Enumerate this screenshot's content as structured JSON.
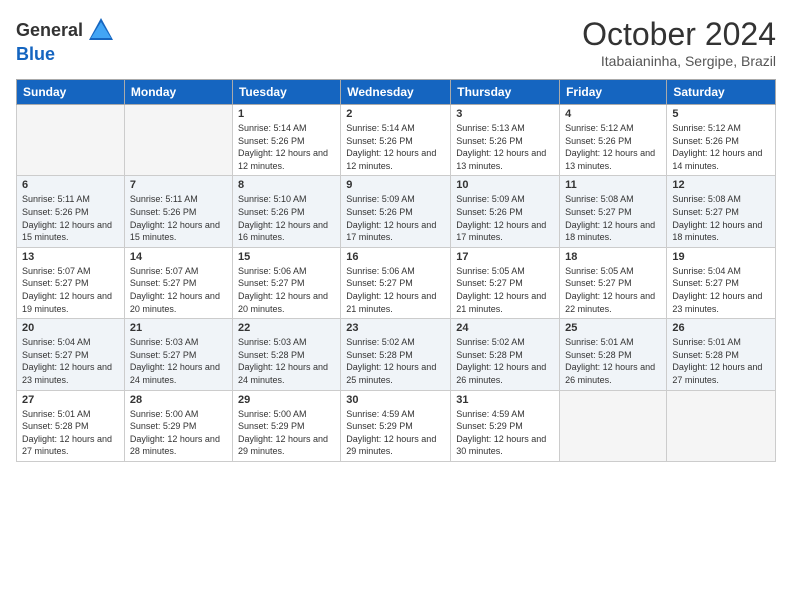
{
  "header": {
    "logo_general": "General",
    "logo_blue": "Blue",
    "month": "October 2024",
    "location": "Itabaianinha, Sergipe, Brazil"
  },
  "days_of_week": [
    "Sunday",
    "Monday",
    "Tuesday",
    "Wednesday",
    "Thursday",
    "Friday",
    "Saturday"
  ],
  "weeks": [
    [
      {
        "day": "",
        "info": ""
      },
      {
        "day": "",
        "info": ""
      },
      {
        "day": "1",
        "info": "Sunrise: 5:14 AM\nSunset: 5:26 PM\nDaylight: 12 hours and 12 minutes."
      },
      {
        "day": "2",
        "info": "Sunrise: 5:14 AM\nSunset: 5:26 PM\nDaylight: 12 hours and 12 minutes."
      },
      {
        "day": "3",
        "info": "Sunrise: 5:13 AM\nSunset: 5:26 PM\nDaylight: 12 hours and 13 minutes."
      },
      {
        "day": "4",
        "info": "Sunrise: 5:12 AM\nSunset: 5:26 PM\nDaylight: 12 hours and 13 minutes."
      },
      {
        "day": "5",
        "info": "Sunrise: 5:12 AM\nSunset: 5:26 PM\nDaylight: 12 hours and 14 minutes."
      }
    ],
    [
      {
        "day": "6",
        "info": "Sunrise: 5:11 AM\nSunset: 5:26 PM\nDaylight: 12 hours and 15 minutes."
      },
      {
        "day": "7",
        "info": "Sunrise: 5:11 AM\nSunset: 5:26 PM\nDaylight: 12 hours and 15 minutes."
      },
      {
        "day": "8",
        "info": "Sunrise: 5:10 AM\nSunset: 5:26 PM\nDaylight: 12 hours and 16 minutes."
      },
      {
        "day": "9",
        "info": "Sunrise: 5:09 AM\nSunset: 5:26 PM\nDaylight: 12 hours and 17 minutes."
      },
      {
        "day": "10",
        "info": "Sunrise: 5:09 AM\nSunset: 5:26 PM\nDaylight: 12 hours and 17 minutes."
      },
      {
        "day": "11",
        "info": "Sunrise: 5:08 AM\nSunset: 5:27 PM\nDaylight: 12 hours and 18 minutes."
      },
      {
        "day": "12",
        "info": "Sunrise: 5:08 AM\nSunset: 5:27 PM\nDaylight: 12 hours and 18 minutes."
      }
    ],
    [
      {
        "day": "13",
        "info": "Sunrise: 5:07 AM\nSunset: 5:27 PM\nDaylight: 12 hours and 19 minutes."
      },
      {
        "day": "14",
        "info": "Sunrise: 5:07 AM\nSunset: 5:27 PM\nDaylight: 12 hours and 20 minutes."
      },
      {
        "day": "15",
        "info": "Sunrise: 5:06 AM\nSunset: 5:27 PM\nDaylight: 12 hours and 20 minutes."
      },
      {
        "day": "16",
        "info": "Sunrise: 5:06 AM\nSunset: 5:27 PM\nDaylight: 12 hours and 21 minutes."
      },
      {
        "day": "17",
        "info": "Sunrise: 5:05 AM\nSunset: 5:27 PM\nDaylight: 12 hours and 21 minutes."
      },
      {
        "day": "18",
        "info": "Sunrise: 5:05 AM\nSunset: 5:27 PM\nDaylight: 12 hours and 22 minutes."
      },
      {
        "day": "19",
        "info": "Sunrise: 5:04 AM\nSunset: 5:27 PM\nDaylight: 12 hours and 23 minutes."
      }
    ],
    [
      {
        "day": "20",
        "info": "Sunrise: 5:04 AM\nSunset: 5:27 PM\nDaylight: 12 hours and 23 minutes."
      },
      {
        "day": "21",
        "info": "Sunrise: 5:03 AM\nSunset: 5:27 PM\nDaylight: 12 hours and 24 minutes."
      },
      {
        "day": "22",
        "info": "Sunrise: 5:03 AM\nSunset: 5:28 PM\nDaylight: 12 hours and 24 minutes."
      },
      {
        "day": "23",
        "info": "Sunrise: 5:02 AM\nSunset: 5:28 PM\nDaylight: 12 hours and 25 minutes."
      },
      {
        "day": "24",
        "info": "Sunrise: 5:02 AM\nSunset: 5:28 PM\nDaylight: 12 hours and 26 minutes."
      },
      {
        "day": "25",
        "info": "Sunrise: 5:01 AM\nSunset: 5:28 PM\nDaylight: 12 hours and 26 minutes."
      },
      {
        "day": "26",
        "info": "Sunrise: 5:01 AM\nSunset: 5:28 PM\nDaylight: 12 hours and 27 minutes."
      }
    ],
    [
      {
        "day": "27",
        "info": "Sunrise: 5:01 AM\nSunset: 5:28 PM\nDaylight: 12 hours and 27 minutes."
      },
      {
        "day": "28",
        "info": "Sunrise: 5:00 AM\nSunset: 5:29 PM\nDaylight: 12 hours and 28 minutes."
      },
      {
        "day": "29",
        "info": "Sunrise: 5:00 AM\nSunset: 5:29 PM\nDaylight: 12 hours and 29 minutes."
      },
      {
        "day": "30",
        "info": "Sunrise: 4:59 AM\nSunset: 5:29 PM\nDaylight: 12 hours and 29 minutes."
      },
      {
        "day": "31",
        "info": "Sunrise: 4:59 AM\nSunset: 5:29 PM\nDaylight: 12 hours and 30 minutes."
      },
      {
        "day": "",
        "info": ""
      },
      {
        "day": "",
        "info": ""
      }
    ]
  ]
}
